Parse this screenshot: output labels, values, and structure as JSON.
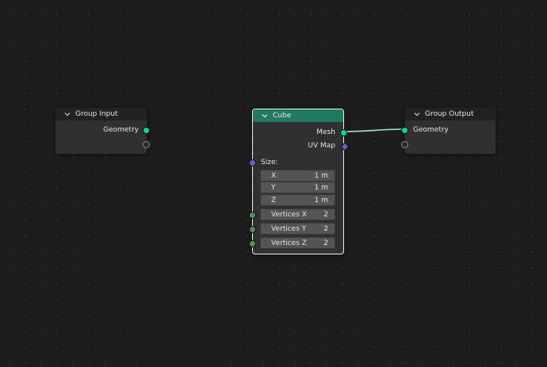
{
  "group_input": {
    "title": "Group Input",
    "outputs": {
      "geometry": "Geometry"
    }
  },
  "cube": {
    "title": "Cube",
    "outputs": {
      "mesh": "Mesh",
      "uv_map": "UV Map"
    },
    "size_label": "Size:",
    "size": [
      {
        "label": "X",
        "value": "1 m"
      },
      {
        "label": "Y",
        "value": "1 m"
      },
      {
        "label": "Z",
        "value": "1 m"
      }
    ],
    "vertices": [
      {
        "label": "Vertices X",
        "value": "2"
      },
      {
        "label": "Vertices Y",
        "value": "2"
      },
      {
        "label": "Vertices Z",
        "value": "2"
      }
    ]
  },
  "group_output": {
    "title": "Group Output",
    "inputs": {
      "geometry": "Geometry"
    }
  },
  "colors": {
    "geometry_socket": "#00d6a3",
    "vector_socket": "#6363c7",
    "integer_socket": "#598c5c",
    "selected_header": "#1f7a5f",
    "link": "#9de8d2"
  }
}
